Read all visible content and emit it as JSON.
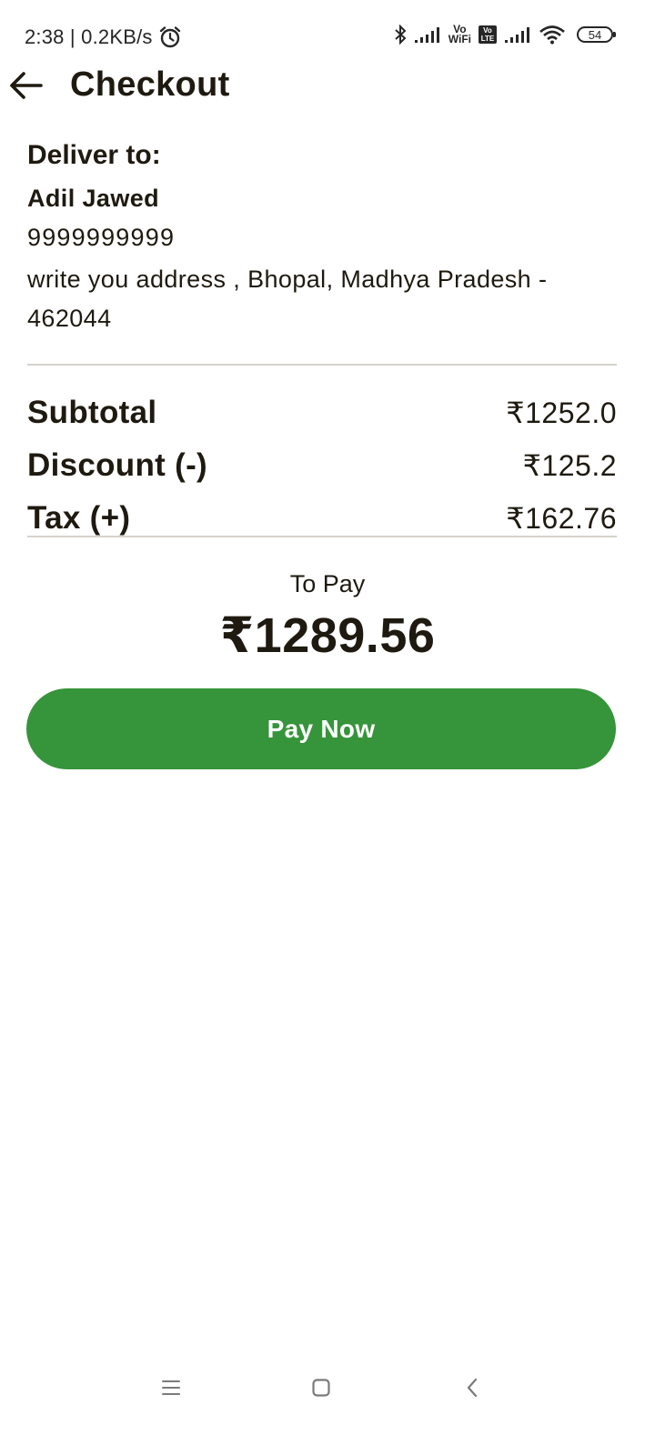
{
  "status_bar": {
    "time_speed": "2:38 | 0.2KB/s",
    "vo_wifi_top": "Vo",
    "vo_wifi_bottom": "WiFi",
    "volte_top": "Vo",
    "volte_bottom": "LTE",
    "battery": "54",
    "icons": [
      "alarm-icon",
      "bluetooth-icon",
      "signal-icon",
      "vo-wifi-icon",
      "volte-icon",
      "signal-icon",
      "wifi-icon",
      "battery-icon"
    ]
  },
  "header": {
    "title": "Checkout",
    "back_icon": "arrow-left-icon"
  },
  "delivery": {
    "heading": "Deliver to:",
    "name": "Adil Jawed",
    "phone": "9999999999",
    "address": "write you address , Bhopal, Madhya Pradesh  - 462044"
  },
  "summary": {
    "rows": [
      {
        "label": "Subtotal",
        "value": "₹1252.0"
      },
      {
        "label": "Discount (-)",
        "value": "₹125.2"
      },
      {
        "label": "Tax (+)",
        "value": "₹162.76"
      }
    ]
  },
  "to_pay": {
    "label": "To Pay",
    "amount": "₹1289.56"
  },
  "pay_button": {
    "label": "Pay Now"
  },
  "nav_bar": {
    "icons": [
      "menu-icon",
      "home-icon",
      "back-icon"
    ]
  },
  "colors": {
    "accent": "#36943a",
    "text": "#1f1a10",
    "divider": "#d6d3cc",
    "background": "#ffffff"
  }
}
